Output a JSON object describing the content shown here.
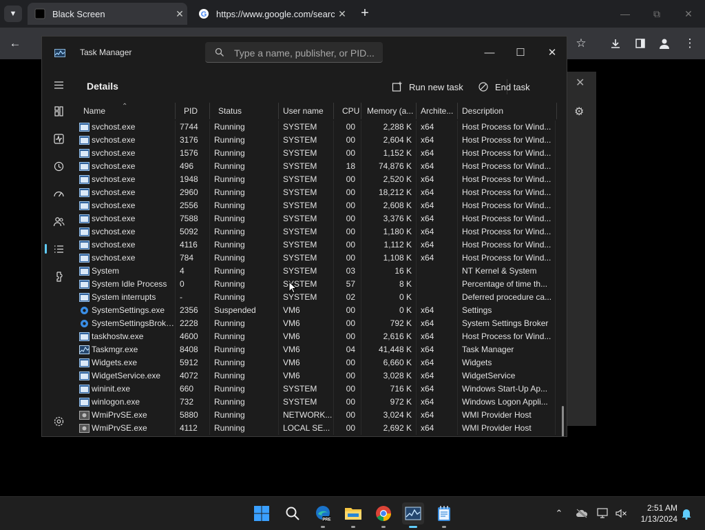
{
  "browser": {
    "tabs": [
      {
        "title": "Black Screen",
        "active": true
      },
      {
        "title": "https://www.google.com/search",
        "active": false
      }
    ],
    "new_tab": "+",
    "close": "✕"
  },
  "taskmgr": {
    "title": "Task Manager",
    "search_placeholder": "Type a name, publisher, or PID...",
    "page_title": "Details",
    "run_new_task": "Run new task",
    "end_task": "End task",
    "more": "...",
    "columns": [
      "Name",
      "PID",
      "Status",
      "User name",
      "CPU",
      "Memory (a...",
      "Archite...",
      "Description"
    ],
    "rows": [
      {
        "name": "svchost.exe",
        "pid": "7744",
        "status": "Running",
        "user": "SYSTEM",
        "cpu": "00",
        "mem": "2,288 K",
        "arch": "x64",
        "desc": "Host Process for Wind...",
        "icon": "service"
      },
      {
        "name": "svchost.exe",
        "pid": "3176",
        "status": "Running",
        "user": "SYSTEM",
        "cpu": "00",
        "mem": "2,604 K",
        "arch": "x64",
        "desc": "Host Process for Wind...",
        "icon": "service"
      },
      {
        "name": "svchost.exe",
        "pid": "1576",
        "status": "Running",
        "user": "SYSTEM",
        "cpu": "00",
        "mem": "1,152 K",
        "arch": "x64",
        "desc": "Host Process for Wind...",
        "icon": "service"
      },
      {
        "name": "svchost.exe",
        "pid": "496",
        "status": "Running",
        "user": "SYSTEM",
        "cpu": "18",
        "mem": "74,876 K",
        "arch": "x64",
        "desc": "Host Process for Wind...",
        "icon": "service"
      },
      {
        "name": "svchost.exe",
        "pid": "1948",
        "status": "Running",
        "user": "SYSTEM",
        "cpu": "00",
        "mem": "2,520 K",
        "arch": "x64",
        "desc": "Host Process for Wind...",
        "icon": "service"
      },
      {
        "name": "svchost.exe",
        "pid": "2960",
        "status": "Running",
        "user": "SYSTEM",
        "cpu": "00",
        "mem": "18,212 K",
        "arch": "x64",
        "desc": "Host Process for Wind...",
        "icon": "service"
      },
      {
        "name": "svchost.exe",
        "pid": "2556",
        "status": "Running",
        "user": "SYSTEM",
        "cpu": "00",
        "mem": "2,608 K",
        "arch": "x64",
        "desc": "Host Process for Wind...",
        "icon": "service"
      },
      {
        "name": "svchost.exe",
        "pid": "7588",
        "status": "Running",
        "user": "SYSTEM",
        "cpu": "00",
        "mem": "3,376 K",
        "arch": "x64",
        "desc": "Host Process for Wind...",
        "icon": "service"
      },
      {
        "name": "svchost.exe",
        "pid": "5092",
        "status": "Running",
        "user": "SYSTEM",
        "cpu": "00",
        "mem": "1,180 K",
        "arch": "x64",
        "desc": "Host Process for Wind...",
        "icon": "service"
      },
      {
        "name": "svchost.exe",
        "pid": "4116",
        "status": "Running",
        "user": "SYSTEM",
        "cpu": "00",
        "mem": "1,112 K",
        "arch": "x64",
        "desc": "Host Process for Wind...",
        "icon": "service"
      },
      {
        "name": "svchost.exe",
        "pid": "784",
        "status": "Running",
        "user": "SYSTEM",
        "cpu": "00",
        "mem": "1,108 K",
        "arch": "x64",
        "desc": "Host Process for Wind...",
        "icon": "service"
      },
      {
        "name": "System",
        "pid": "4",
        "status": "Running",
        "user": "SYSTEM",
        "cpu": "03",
        "mem": "16 K",
        "arch": "",
        "desc": "NT Kernel & System",
        "icon": "service"
      },
      {
        "name": "System Idle Process",
        "pid": "0",
        "status": "Running",
        "user": "SYSTEM",
        "cpu": "57",
        "mem": "8 K",
        "arch": "",
        "desc": "Percentage of time th...",
        "icon": "service"
      },
      {
        "name": "System interrupts",
        "pid": "-",
        "status": "Running",
        "user": "SYSTEM",
        "cpu": "02",
        "mem": "0 K",
        "arch": "",
        "desc": "Deferred procedure ca...",
        "icon": "service"
      },
      {
        "name": "SystemSettings.exe",
        "pid": "2356",
        "status": "Suspended",
        "user": "VM6",
        "cpu": "00",
        "mem": "0 K",
        "arch": "x64",
        "desc": "Settings",
        "icon": "gear"
      },
      {
        "name": "SystemSettingsBroke...",
        "pid": "2228",
        "status": "Running",
        "user": "VM6",
        "cpu": "00",
        "mem": "792 K",
        "arch": "x64",
        "desc": "System Settings Broker",
        "icon": "gear"
      },
      {
        "name": "taskhostw.exe",
        "pid": "4600",
        "status": "Running",
        "user": "VM6",
        "cpu": "00",
        "mem": "2,616 K",
        "arch": "x64",
        "desc": "Host Process for Wind...",
        "icon": "service"
      },
      {
        "name": "Taskmgr.exe",
        "pid": "8408",
        "status": "Running",
        "user": "VM6",
        "cpu": "04",
        "mem": "41,448 K",
        "arch": "x64",
        "desc": "Task Manager",
        "icon": "taskmgr"
      },
      {
        "name": "Widgets.exe",
        "pid": "5912",
        "status": "Running",
        "user": "VM6",
        "cpu": "00",
        "mem": "6,660 K",
        "arch": "x64",
        "desc": "Widgets",
        "icon": "service"
      },
      {
        "name": "WidgetService.exe",
        "pid": "4072",
        "status": "Running",
        "user": "VM6",
        "cpu": "00",
        "mem": "3,028 K",
        "arch": "x64",
        "desc": "WidgetService",
        "icon": "service"
      },
      {
        "name": "wininit.exe",
        "pid": "660",
        "status": "Running",
        "user": "SYSTEM",
        "cpu": "00",
        "mem": "716 K",
        "arch": "x64",
        "desc": "Windows Start-Up Ap...",
        "icon": "service"
      },
      {
        "name": "winlogon.exe",
        "pid": "732",
        "status": "Running",
        "user": "SYSTEM",
        "cpu": "00",
        "mem": "972 K",
        "arch": "x64",
        "desc": "Windows Logon Appli...",
        "icon": "service"
      },
      {
        "name": "WmiPrvSE.exe",
        "pid": "5880",
        "status": "Running",
        "user": "NETWORK...",
        "cpu": "00",
        "mem": "3,024 K",
        "arch": "x64",
        "desc": "WMI Provider Host",
        "icon": "wmi"
      },
      {
        "name": "WmiPrvSE.exe",
        "pid": "4112",
        "status": "Running",
        "user": "LOCAL SE...",
        "cpu": "00",
        "mem": "2,692 K",
        "arch": "x64",
        "desc": "WMI Provider Host",
        "icon": "wmi"
      }
    ]
  },
  "taskbar": {
    "time": "2:51 AM",
    "date": "1/13/2024",
    "edge_badge": "PRE"
  },
  "colors": {
    "accent": "#60cdff",
    "window_bg": "#1c1c1c",
    "taskbar_bg": "#1f1f1f"
  }
}
